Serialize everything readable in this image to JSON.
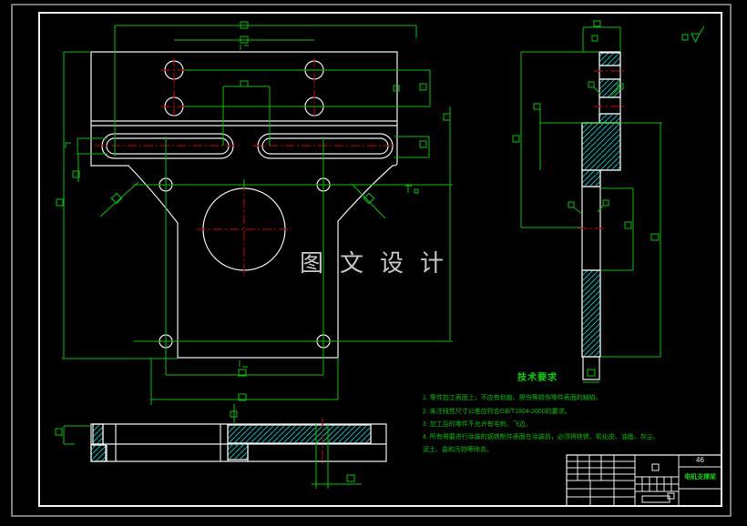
{
  "colors": {
    "white": "#eeeeee",
    "green": "#00c400",
    "red": "#b40000",
    "cyan": "#00bebe",
    "gray": "#9a9a9a",
    "watermark": "#d8d8d8",
    "titlegreen": "#00d800",
    "bg": "#000000"
  },
  "watermark": "图文设计",
  "tech_requirements": {
    "title": "技术要求",
    "items": [
      "1. 零件加工表面上，不应有划痕、擦伤等损伤零件表面的缺陷。",
      "2. 未注线性尺寸公差应符合GB/T1804-2000的要求。",
      "3. 加工后的零件不允许有毛刺、飞边。",
      "4. 所有需要进行涂装的钢铁制件表面在涂装前，必须将铁锈、氧化皮、油脂、灰尘、",
      "泥土、盐和污物等除去。"
    ]
  },
  "title_block": {
    "material": "46",
    "part_name": "电机支撑架"
  },
  "symbols": {
    "surface_roughness": "triangle-check roughness mark",
    "dimension_text_placeholder": "small green square"
  }
}
